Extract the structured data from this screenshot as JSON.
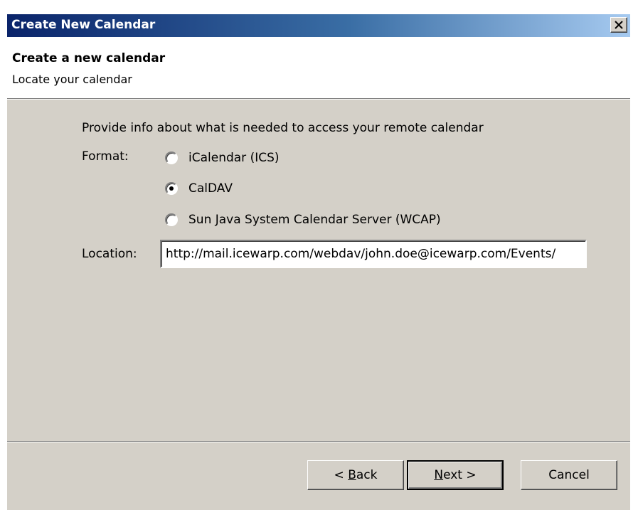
{
  "window": {
    "title": "Create New Calendar",
    "close_icon": "close-icon"
  },
  "header": {
    "title": "Create a new calendar",
    "subtitle": "Locate your calendar"
  },
  "form": {
    "intro": "Provide info about what is needed to access your remote calendar",
    "format_label": "Format:",
    "format_options": [
      {
        "label": "iCalendar (ICS)",
        "checked": false
      },
      {
        "label": "CalDAV",
        "checked": true
      },
      {
        "label": "Sun Java System Calendar Server (WCAP)",
        "checked": false
      }
    ],
    "location_label": "Location:",
    "location_value": "http://mail.icewarp.com/webdav/john.doe@icewarp.com/Events/"
  },
  "buttons": {
    "back_pre": "< ",
    "back_mnemonic": "B",
    "back_post": "ack",
    "next_mnemonic": "N",
    "next_post": "ext >",
    "cancel": "Cancel"
  }
}
